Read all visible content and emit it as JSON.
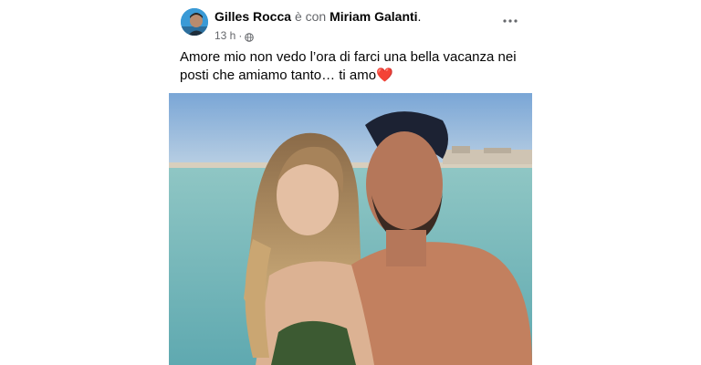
{
  "post": {
    "author_name": "Gilles Rocca",
    "with_text": "è con",
    "tagged_name": "Miriam Galanti",
    "period": ".",
    "time": "13 h",
    "separator": "·",
    "audience_icon": "globe-icon",
    "more_icon": "more-options-icon",
    "caption": "Amore mio non vedo l’ora di farci una bella vacanza nei posti che amiamo tanto… ti amo",
    "caption_emoji": "❤️"
  },
  "colors": {
    "text_primary": "#050505",
    "text_secondary": "#65676b",
    "heart": "#e0245e"
  }
}
